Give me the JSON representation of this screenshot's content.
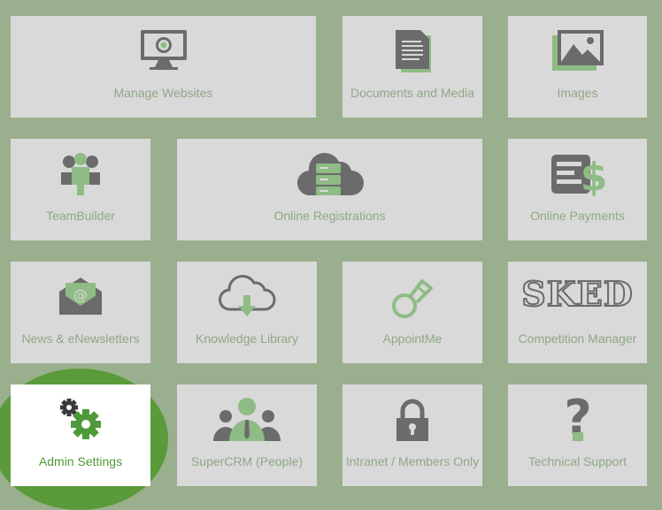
{
  "tiles": [
    {
      "label": "Manage Websites",
      "icon": "monitor-icon"
    },
    {
      "label": "Documents and Media",
      "icon": "document-icon"
    },
    {
      "label": "Images",
      "icon": "image-icon"
    },
    {
      "label": "TeamBuilder",
      "icon": "team-icon"
    },
    {
      "label": "Online Registrations",
      "icon": "cloud-database-icon"
    },
    {
      "label": "Online Payments",
      "icon": "payment-icon"
    },
    {
      "label": "News & eNewsletters",
      "icon": "envelope-icon"
    },
    {
      "label": "Knowledge Library",
      "icon": "cloud-download-icon"
    },
    {
      "label": "AppointMe",
      "icon": "whistle-icon"
    },
    {
      "label": "Competition Manager",
      "icon": "sked-logo",
      "logo_text": "SKED"
    },
    {
      "label": "Admin Settings",
      "icon": "gear-icon"
    },
    {
      "label": "SuperCRM (People)",
      "icon": "people-icon"
    },
    {
      "label": "Intranet / Members Only",
      "icon": "lock-icon"
    },
    {
      "label": "Technical Support",
      "icon": "question-icon"
    }
  ],
  "colors": {
    "background": "#9aaf8d",
    "tile": "#d9d9d9",
    "label": "#8fa886",
    "icon_dark": "#6b6b6b",
    "icon_accent": "#8fbb85",
    "highlight": "#5a9a3a",
    "active_label": "#4f9a38"
  },
  "active_tile": "Admin Settings"
}
